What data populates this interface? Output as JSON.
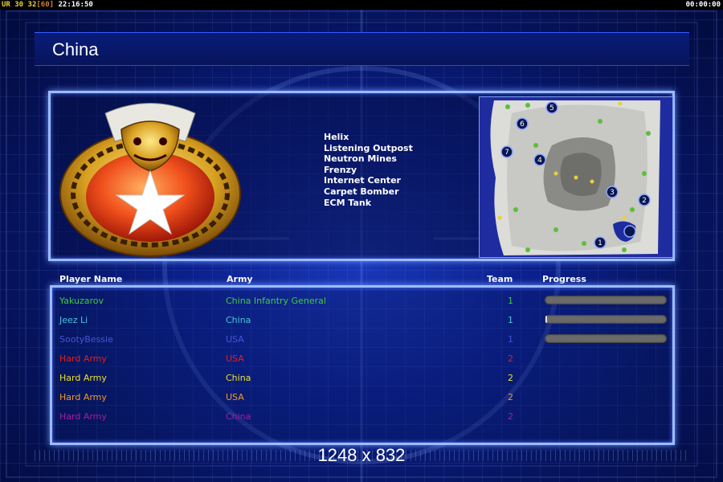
{
  "topbar": {
    "ur": "UR",
    "num_a": "30",
    "num_b": "32",
    "max": "[60]",
    "clock": "22:16:50",
    "timer": "00:00:00"
  },
  "title": "China",
  "units": [
    "Helix",
    "Listening Outpost",
    "Neutron Mines",
    "Frenzy",
    "Internet Center",
    "Carpet Bomber",
    "ECM Tank"
  ],
  "headers": {
    "player": "Player Name",
    "army": "Army",
    "team": "Team",
    "progress": "Progress"
  },
  "players": [
    {
      "name": "Yakuzarov",
      "army": "China Infantry General",
      "team": "1",
      "color": "#3fcc3f",
      "progress": 0.0
    },
    {
      "name": "Jeez Li",
      "army": "China",
      "team": "1",
      "color": "#46c8d8",
      "progress": 0.01
    },
    {
      "name": "SootyBessie",
      "army": "USA",
      "team": "1",
      "color": "#4655d8",
      "progress": 0.0
    },
    {
      "name": "Hard Army",
      "army": "USA",
      "team": "2",
      "color": "#e0201c",
      "progress": null
    },
    {
      "name": "Hard Army",
      "army": "China",
      "team": "2",
      "color": "#e8e030",
      "progress": null
    },
    {
      "name": "Hard Army",
      "army": "USA",
      "team": "2",
      "color": "#f09a20",
      "progress": null
    },
    {
      "name": "Hard Army",
      "army": "China",
      "team": "2",
      "color": "#a01fa0",
      "progress": null
    }
  ],
  "minimap_labels": [
    "1",
    "2",
    "3",
    "4",
    "5",
    "6",
    "7"
  ],
  "resolution": "1248 x 832",
  "colors": {
    "accent": "#9bbcff",
    "background": "#0b1f8a"
  }
}
